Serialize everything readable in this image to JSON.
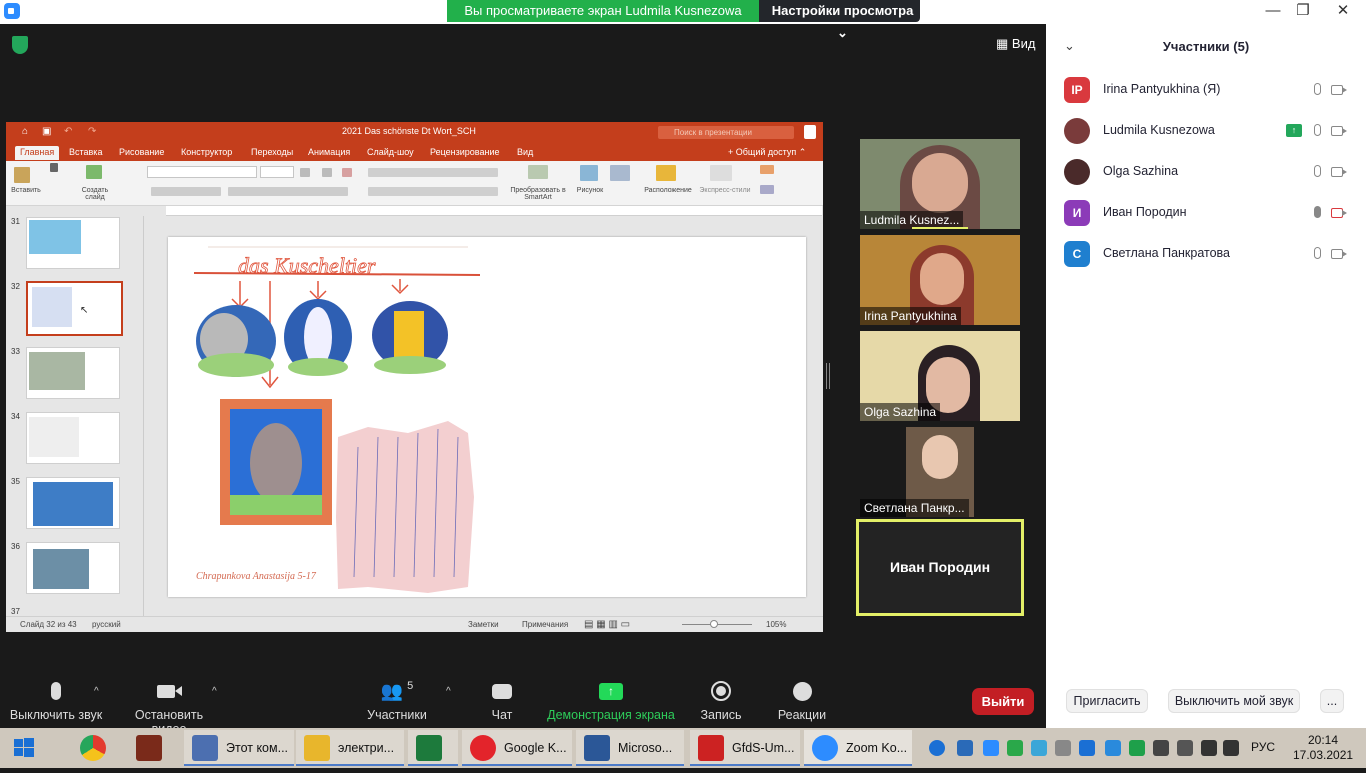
{
  "zoom": {
    "banner_text": "Вы просматриваете экран Ludmila Kusnezowa",
    "view_settings_label": "Настройки просмотра",
    "view_button_label": "Вид",
    "toolbar": {
      "mute_label": "Выключить звук",
      "video_label": "Остановить видео",
      "participants_label": "Участники",
      "participants_count": "5",
      "chat_label": "Чат",
      "share_label": "Демонстрация экрана",
      "record_label": "Запись",
      "reactions_label": "Реакции",
      "leave_label": "Выйти"
    },
    "video_tiles": [
      {
        "name": "Ludmila Kusnez..."
      },
      {
        "name": "Irina Pantyukhina"
      },
      {
        "name": "Olga Sazhina"
      },
      {
        "name": "Светлана Панкр..."
      }
    ],
    "active_speaker": "Иван Породин"
  },
  "panel": {
    "title": "Участники (5)",
    "participants": [
      {
        "initials": "IP",
        "name": "Irina Pantyukhina (Я)",
        "color": "#d9393e"
      },
      {
        "initials": "",
        "name": "Ludmila Kusnezowa",
        "color": "#7a3b3b"
      },
      {
        "initials": "",
        "name": "Olga Sazhina",
        "color": "#4a2a2a"
      },
      {
        "initials": "И",
        "name": "Иван Породин",
        "color": "#8c3bb8"
      },
      {
        "initials": "С",
        "name": "Светлана Панкратова",
        "color": "#1f7fcf"
      }
    ],
    "invite_label": "Пригласить",
    "mute_me_label": "Выключить мой звук",
    "more_label": "..."
  },
  "ppt": {
    "doc_title": "2021 Das schönste Dt Wort_SCH",
    "search_placeholder": "Поиск в презентации",
    "tabs": [
      "Главная",
      "Вставка",
      "Рисование",
      "Конструктор",
      "Переходы",
      "Анимация",
      "Слайд-шоу",
      "Рецензирование",
      "Вид"
    ],
    "share_label": "Общий доступ",
    "ribbon": {
      "paste": "Вставить",
      "new_slide": "Создать слайд",
      "smartart": "Преобразовать в SmartArt",
      "picture": "Рисунок",
      "arrange": "Расположение",
      "styles": "Экспресс-стили"
    },
    "slide_numbers": [
      "31",
      "32",
      "33",
      "34",
      "35",
      "36",
      "37"
    ],
    "selected_slide": "32",
    "slide_heading": "das Kuscheltier",
    "slide_signature": "Chrapunkova Anastasija 5-17",
    "status": {
      "slide_info": "Слайд 32 из 43",
      "language": "русский",
      "notes": "Заметки",
      "comments": "Примечания",
      "zoom": "105%"
    }
  },
  "taskbar": {
    "items": [
      {
        "label": "",
        "color": "#dddddd"
      },
      {
        "label": "",
        "color": "#7a2a1a"
      },
      {
        "label": "Этот ком...",
        "color": "#4c6fb0"
      },
      {
        "label": "электри...",
        "color": "#e8b62c"
      },
      {
        "label": "",
        "color": "#1d7a3c"
      },
      {
        "label": "Google K...",
        "color": "#e3242b"
      },
      {
        "label": "Microso...",
        "color": "#2b5797"
      },
      {
        "label": "GfdS-Um...",
        "color": "#cc2222"
      },
      {
        "label": "Zoom Ko...",
        "color": "#2d8cff"
      }
    ],
    "language": "РУС",
    "time": "20:14",
    "date": "17.03.2021"
  }
}
